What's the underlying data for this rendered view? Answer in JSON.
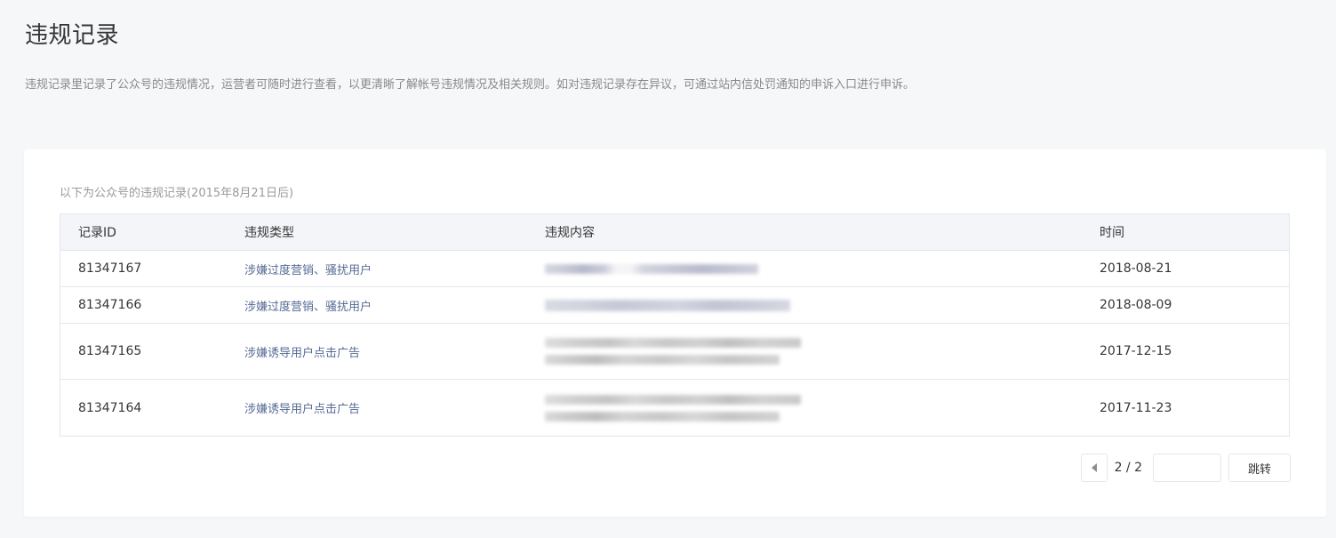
{
  "page": {
    "title": "违规记录",
    "description": "违规记录里记录了公众号的违规情况，运营者可随时进行查看，以更清晰了解帐号违规情况及相关规则。如对违规记录存在异议，可通过站内信处罚通知的申诉入口进行申诉。"
  },
  "card": {
    "caption": "以下为公众号的违规记录(2015年8月21日后)"
  },
  "table": {
    "headers": {
      "id": "记录ID",
      "type": "违规类型",
      "content": "违规内容",
      "time": "时间"
    },
    "rows": [
      {
        "id": "81347167",
        "type": "涉嫌过度营销、骚扰用户",
        "time": "2018-08-21",
        "content_lines": 1
      },
      {
        "id": "81347166",
        "type": "涉嫌过度营销、骚扰用户",
        "time": "2018-08-09",
        "content_lines": 1
      },
      {
        "id": "81347165",
        "type": "涉嫌诱导用户点击广告",
        "time": "2017-12-15",
        "content_lines": 2
      },
      {
        "id": "81347164",
        "type": "涉嫌诱导用户点击广告",
        "time": "2017-11-23",
        "content_lines": 2
      }
    ]
  },
  "pagination": {
    "info": "2 / 2",
    "input_value": "",
    "jump_label": "跳转",
    "prev_icon": "triangle-left-icon"
  },
  "colors": {
    "background": "#f6f7f9",
    "card": "#ffffff",
    "link": "#576b95",
    "border": "#e4e6eb",
    "header_bg": "#f4f5f8"
  }
}
